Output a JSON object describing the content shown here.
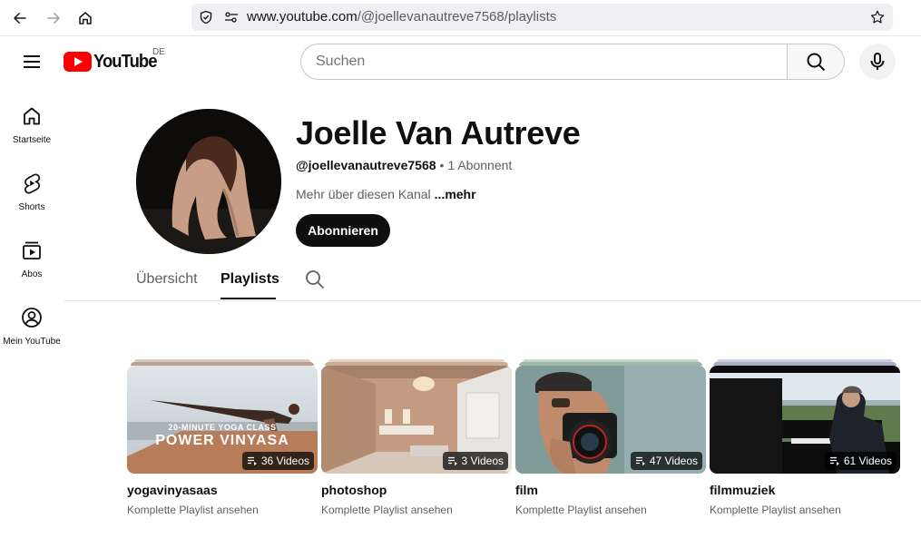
{
  "browser": {
    "url_host": "www.youtube.com",
    "url_path": "/@joellevanautreve7568/playlists"
  },
  "header": {
    "logo_text": "YouTube",
    "region": "DE",
    "search_placeholder": "Suchen"
  },
  "guide": {
    "items": [
      {
        "label": "Startseite",
        "icon": "home-icon"
      },
      {
        "label": "Shorts",
        "icon": "shorts-icon"
      },
      {
        "label": "Abos",
        "icon": "subscriptions-icon"
      },
      {
        "label": "Mein YouTube",
        "icon": "account-icon"
      }
    ]
  },
  "channel": {
    "name": "Joelle Van Autreve",
    "handle": "@joellevanautreve7568",
    "separator": "•",
    "subscribers": "1 Abonnent",
    "about": "Mehr über diesen Kanal",
    "more": "...mehr",
    "subscribe_label": "Abonnieren"
  },
  "tabs": {
    "overview": "Übersicht",
    "playlists": "Playlists",
    "active": "playlists"
  },
  "playlists": [
    {
      "title": "yogavinyasaas",
      "count": "36 Videos",
      "link": "Komplette Playlist ansehen",
      "thumb_overlay_small": "20-MINUTE YOGA CLASS",
      "thumb_overlay_big": "POWER VINYASA",
      "stack_colors": [
        "#d9c8be",
        "#b9a294"
      ]
    },
    {
      "title": "photoshop",
      "count": "3 Videos",
      "link": "Komplette Playlist ansehen",
      "stack_colors": [
        "#e6d3c4",
        "#c9ad97"
      ]
    },
    {
      "title": "film",
      "count": "47 Videos",
      "link": "Komplette Playlist ansehen",
      "stack_colors": [
        "#c4d6c8",
        "#9fb7a5"
      ]
    },
    {
      "title": "filmmuziek",
      "count": "61 Videos",
      "link": "Komplette Playlist ansehen",
      "stack_colors": [
        "#cdd0e0",
        "#a9adc6"
      ]
    }
  ],
  "colors": {
    "brand_red": "#ff0000",
    "text_primary": "#0f0f0f",
    "text_secondary": "#606060"
  }
}
